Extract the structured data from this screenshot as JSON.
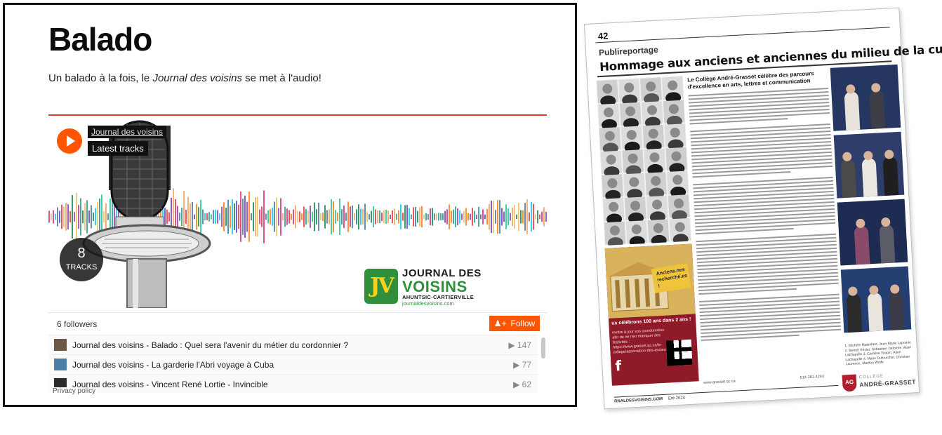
{
  "web": {
    "title": "Balado",
    "intro_prefix": "Un balado à la fois, le ",
    "intro_em": "Journal des voisins",
    "intro_suffix": " se met à l'audio!",
    "accent_color": "#ff5500",
    "rule_color": "#d9432a",
    "player": {
      "user": "Journal des voisins",
      "playlist": "Latest tracks",
      "tracks_count": "8",
      "tracks_label": "TRACKS",
      "logo": {
        "line1": "JOURNAL DES",
        "line2": "VOISINS",
        "line3": "AHUNTSIC-CARTIERVILLE",
        "line4": "journaldesvoisins.com",
        "mark": "JV"
      }
    },
    "followers": "6 followers",
    "follow_label": "Follow",
    "tracks": [
      {
        "title": "Journal des voisins - Balado : Quel sera l'avenir du métier du cordonnier ?",
        "plays": "▶ 147"
      },
      {
        "title": "Journal des voisins - La garderie l'Abri voyage à Cuba",
        "plays": "▶ 77"
      },
      {
        "title": "Journal des voisins - Vincent René Lortie - Invincible",
        "plays": "▶ 62"
      }
    ],
    "privacy": "Privacy policy"
  },
  "magazine": {
    "page_number": "42",
    "section": "Publireportage",
    "headline": "Hommage aux anciens et anciennes du milieu de la culture québécoise !",
    "subhead": "Le Collège André-Grasset célèbre des parcours d'excellence en arts, lettres et communication",
    "promo_sign": "Anciens.nes recherché.es !",
    "promo_title": "us célébrons 100 ans dans 2 ans !",
    "promo_text": "mettre à jour vos coordonnées afin de ne rien manquer des festivités : https://www.grasset.qc.ca/le-college/association-des-anciens/",
    "promo_fb": "f",
    "caption": "1. Michèle Malenfant, Jean-Marie Lapointe 2. Benoît Vézier, Sébastien Delorme, Alain Lachapelle 3. Caroline Toupin, Alain Lachapelle 4. Marie Dufourchel, Christian Laurence, Marilou Wolfe",
    "website": "www.grasset.qc.ca",
    "phone": "514-381-4293",
    "logo_small": "COLLÈGE",
    "logo_big": "ANDRÉ-GRASSET",
    "logo_mark": "AG",
    "footer_site": "RNALDESVOISINS.COM",
    "footer_season": "Été 2024"
  }
}
